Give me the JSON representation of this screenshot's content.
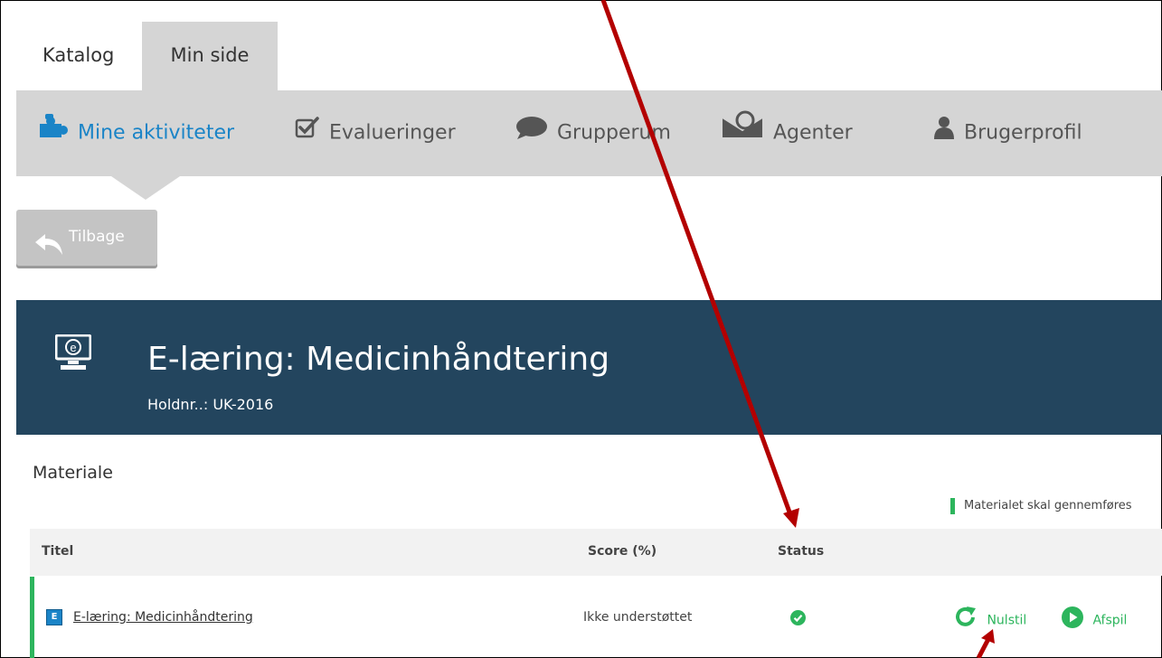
{
  "top_tabs": [
    {
      "label": "Katalog",
      "active": false
    },
    {
      "label": "Min side",
      "active": true
    }
  ],
  "subnav": {
    "items": [
      {
        "label": "Mine aktiviteter",
        "icon": "puzzle-icon",
        "active": true
      },
      {
        "label": "Evalueringer",
        "icon": "checkbox-icon",
        "active": false
      },
      {
        "label": "Grupperum",
        "icon": "chat-bubble-icon",
        "active": false
      },
      {
        "label": "Agenter",
        "icon": "mail-search-icon",
        "active": false
      },
      {
        "label": "Brugerprofil",
        "icon": "user-icon",
        "active": false
      }
    ]
  },
  "back_button": {
    "label": "Tilbage",
    "icon": "back-arrow-icon"
  },
  "course": {
    "title": "E-læring: Medicinhåndtering",
    "team_number": "Holdnr..: UK-2016",
    "icon": "monitor-e-icon"
  },
  "material": {
    "section_title": "Materiale",
    "note": "Materialet skal gennemføres",
    "columns": [
      "Titel",
      "Score (%)",
      "Status"
    ],
    "rows": [
      {
        "badge": "E",
        "title": "E-læring: Medicinhåndtering",
        "score": "Ikke understøttet",
        "status_icon": "check-circle-icon",
        "actions": [
          {
            "label": "Nulstil",
            "icon": "reset-icon"
          },
          {
            "label": "Afspil",
            "icon": "play-icon"
          }
        ]
      }
    ]
  },
  "colors": {
    "accent_blue": "#1a84c7",
    "header_bg": "#23455e",
    "nav_bg": "#d5d5d5",
    "success_green": "#2db55d",
    "annotation_arrow": "#b30000"
  }
}
